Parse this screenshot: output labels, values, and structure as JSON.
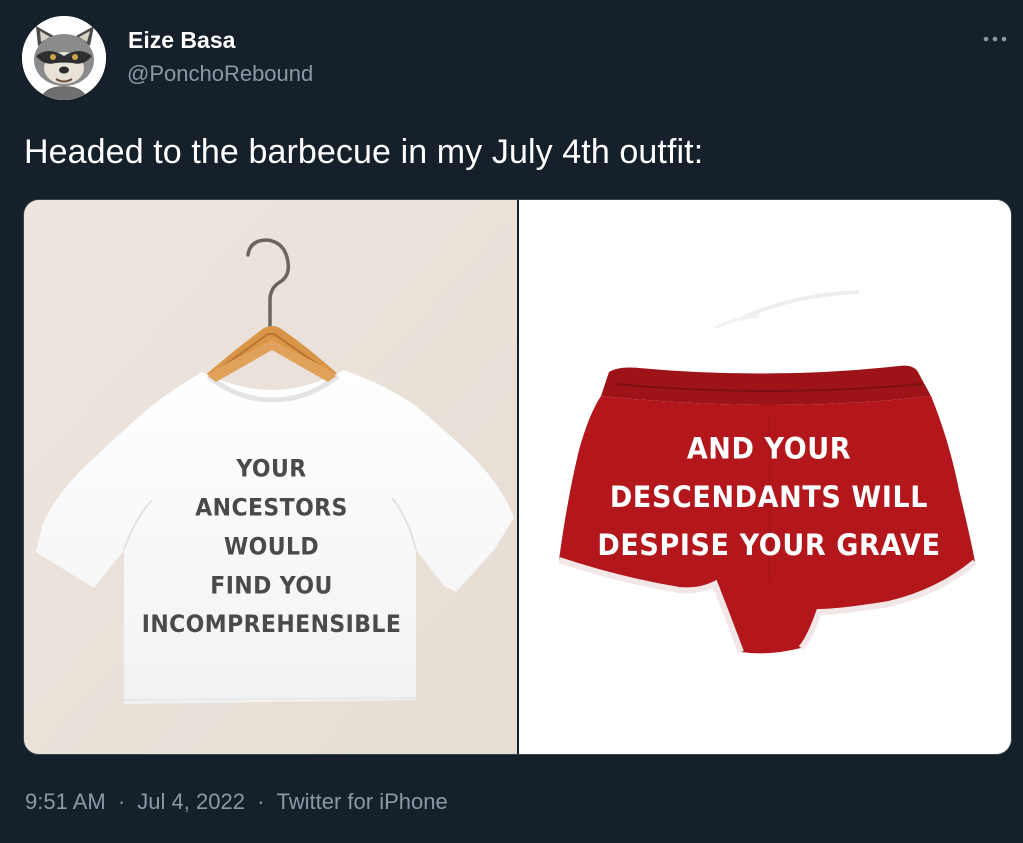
{
  "author": {
    "display_name": "Eize Basa",
    "handle": "@PonchoRebound",
    "avatar_icon": "raccoon-avatar"
  },
  "more_icon": "more-horizontal-icon",
  "tweet": {
    "text": "Headed to the barbecue in my July 4th outfit:"
  },
  "media": {
    "shirt": {
      "lines": [
        "YOUR",
        "ANCESTORS",
        "WOULD",
        "FIND YOU",
        "INCOMPREHENSIBLE"
      ]
    },
    "shorts": {
      "lines": [
        "AND YOUR",
        "DESCENDANTS WILL",
        "DESPISE YOUR GRAVE"
      ]
    }
  },
  "meta": {
    "time": "9:51 AM",
    "separator": "·",
    "date": "Jul 4, 2022",
    "source": "Twitter for iPhone"
  },
  "colors": {
    "background": "#15202b",
    "secondary_text": "#8b98a5",
    "shorts_red": "#b3161b"
  }
}
